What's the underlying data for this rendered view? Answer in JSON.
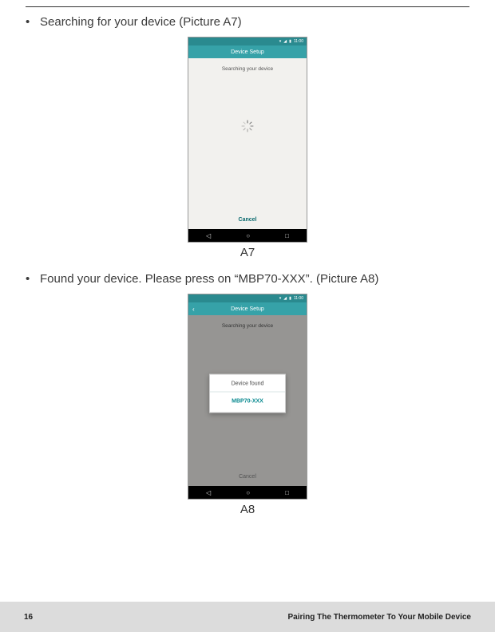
{
  "bullets": {
    "b1": "Searching for your device (Picture A7)",
    "b2": "Found your device. Please press on “MBP70-XXX”. (Picture A8)"
  },
  "phone": {
    "status_time": "11:00",
    "title": "Device Setup",
    "subtitle": "Searching your device",
    "cancel": "Cancel",
    "dialog_title": "Device found",
    "dialog_item": "MBP70-XXX"
  },
  "captions": {
    "a7": "A7",
    "a8": "A8"
  },
  "footer": {
    "page": "16",
    "section": "Pairing The Thermometer To Your Mobile Device"
  }
}
